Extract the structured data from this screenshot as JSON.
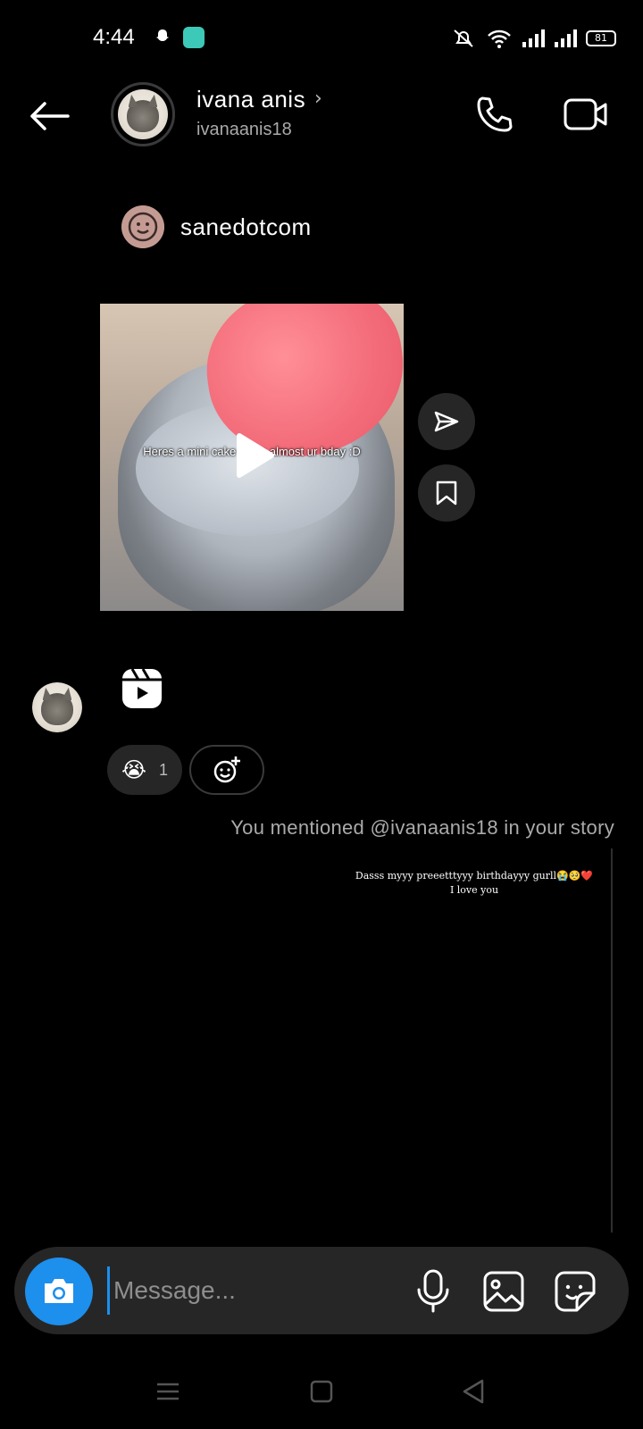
{
  "status_bar": {
    "time": "4:44",
    "battery": "81",
    "icons": [
      "snapchat-icon",
      "app-notification-icon",
      "mute-icon",
      "wifi-icon",
      "signal-icon",
      "signal-icon",
      "battery-icon"
    ]
  },
  "header": {
    "name": "ivana anis",
    "username": "ivanaanis18",
    "chevron": "›"
  },
  "post": {
    "author": "sanedotcom",
    "caption": "Heres a mini cake bc its almost ur bday :D"
  },
  "reaction": {
    "emoji": "😭",
    "count": "1"
  },
  "mention": {
    "text": "You mentioned @ivanaanis18 in your story"
  },
  "story": {
    "line1": "Dasss myyy preeetttyyy birthdayyy gurll😭🥺❤️",
    "line2": "I love you"
  },
  "composer": {
    "placeholder": "Message..."
  },
  "colors": {
    "background": "#000000",
    "accent": "#1d8fed",
    "bubble": "#262626",
    "muted_text": "#8e8e8e"
  }
}
